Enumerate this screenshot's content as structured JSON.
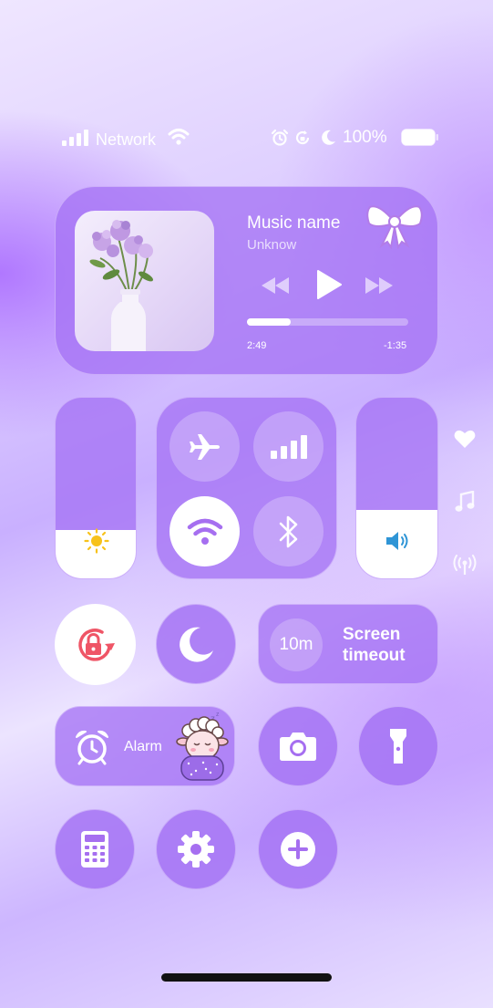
{
  "status_bar": {
    "carrier": "Network",
    "battery": "100%"
  },
  "media": {
    "title": "Music name",
    "artist": "Unknow",
    "elapsed": "2:49",
    "remaining": "-1:35",
    "progress": 0.27
  },
  "brightness": {
    "level": 0.27
  },
  "volume": {
    "level": 0.38
  },
  "screen_timeout": {
    "value": "10m",
    "label_line1": "Screen",
    "label_line2": "timeout"
  },
  "alarm": {
    "label": "Alarm"
  },
  "colors": {
    "accent": "#a66ff0",
    "tile": "#a873f5",
    "white": "#ffffff",
    "lock_red": "#ef5566",
    "volume_blue": "#2f95d6",
    "sun_yellow": "#f7c21b"
  }
}
